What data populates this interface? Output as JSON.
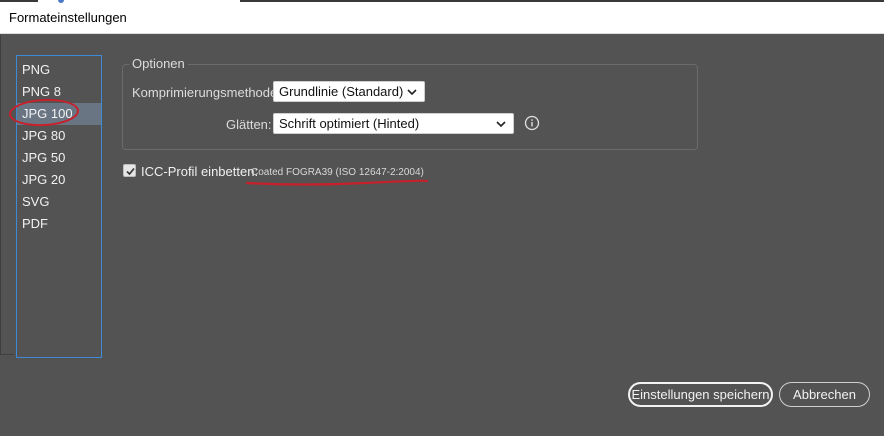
{
  "window": {
    "title": "Formateinstellungen"
  },
  "formats": {
    "items": [
      {
        "label": "PNG"
      },
      {
        "label": "PNG 8"
      },
      {
        "label": "JPG 100"
      },
      {
        "label": "JPG 80"
      },
      {
        "label": "JPG 50"
      },
      {
        "label": "JPG 20"
      },
      {
        "label": "SVG"
      },
      {
        "label": "PDF"
      }
    ],
    "selected": "JPG 100"
  },
  "options": {
    "legend": "Optionen",
    "compression_label": "Komprimierungsmethode:",
    "compression_value": "Grundlinie (Standard)",
    "smoothing_label": "Glätten:",
    "smoothing_value": "Schrift optimiert (Hinted)"
  },
  "icc": {
    "checked": true,
    "label": "ICC-Profil einbetten:",
    "profile": "Coated FOGRA39 (ISO 12647-2:2004)"
  },
  "buttons": {
    "save": "Einstellungen speichern",
    "cancel": "Abbrechen"
  },
  "colors": {
    "background": "#535353",
    "selection": "#6a7583",
    "list_border": "#3c8ad8",
    "annotation_red": "#c8202a"
  },
  "icons": {
    "dropdown": "chevron-down-icon",
    "info": "info-icon",
    "checkbox": "checkmark-icon"
  }
}
